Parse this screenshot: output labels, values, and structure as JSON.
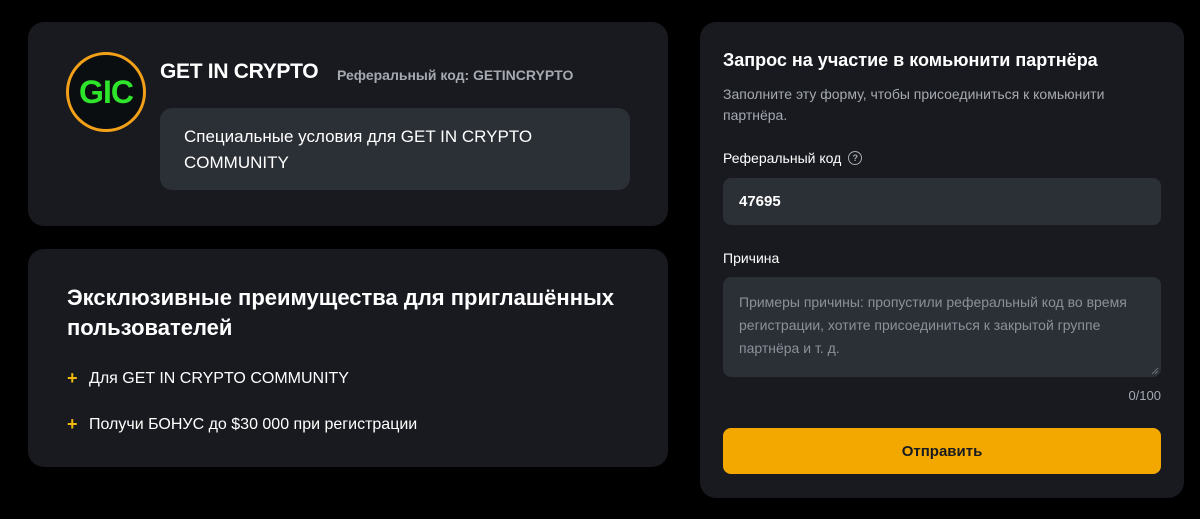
{
  "partner_card": {
    "logo_text": "GIC",
    "name": "GET IN CRYPTO",
    "referral_code_label": "Реферальный код: GETINCRYPTO",
    "special_conditions": "Специальные условия для GET IN CRYPTO COMMUNITY"
  },
  "benefits_card": {
    "title": "Эксклюзивные преимущества для приглашённых пользователей",
    "items": [
      {
        "icon": "+",
        "text": "Для GET IN CRYPTO COMMUNITY"
      },
      {
        "icon": "+",
        "text": "Получи БОНУС до $30 000 при регистрации"
      }
    ]
  },
  "form": {
    "title": "Запрос на участие в комьюнити партнёра",
    "subtitle": "Заполните эту форму, чтобы присоединиться к комьюнити партнёра.",
    "referral_label": "Реферальный код",
    "help_icon": "?",
    "referral_value": "47695",
    "reason_label": "Причина",
    "reason_placeholder": "Примеры причины: пропустили реферальный код во время регистрации, хотите присоединиться к закрытой группе партнёра и т. д.",
    "counter": "0/100",
    "submit_label": "Отправить"
  },
  "colors": {
    "background": "#000000",
    "card": "#181a20",
    "input": "#2b2f36",
    "accent": "#f3a800",
    "logo_green": "#2ee52b",
    "logo_ring": "#f3a019"
  }
}
